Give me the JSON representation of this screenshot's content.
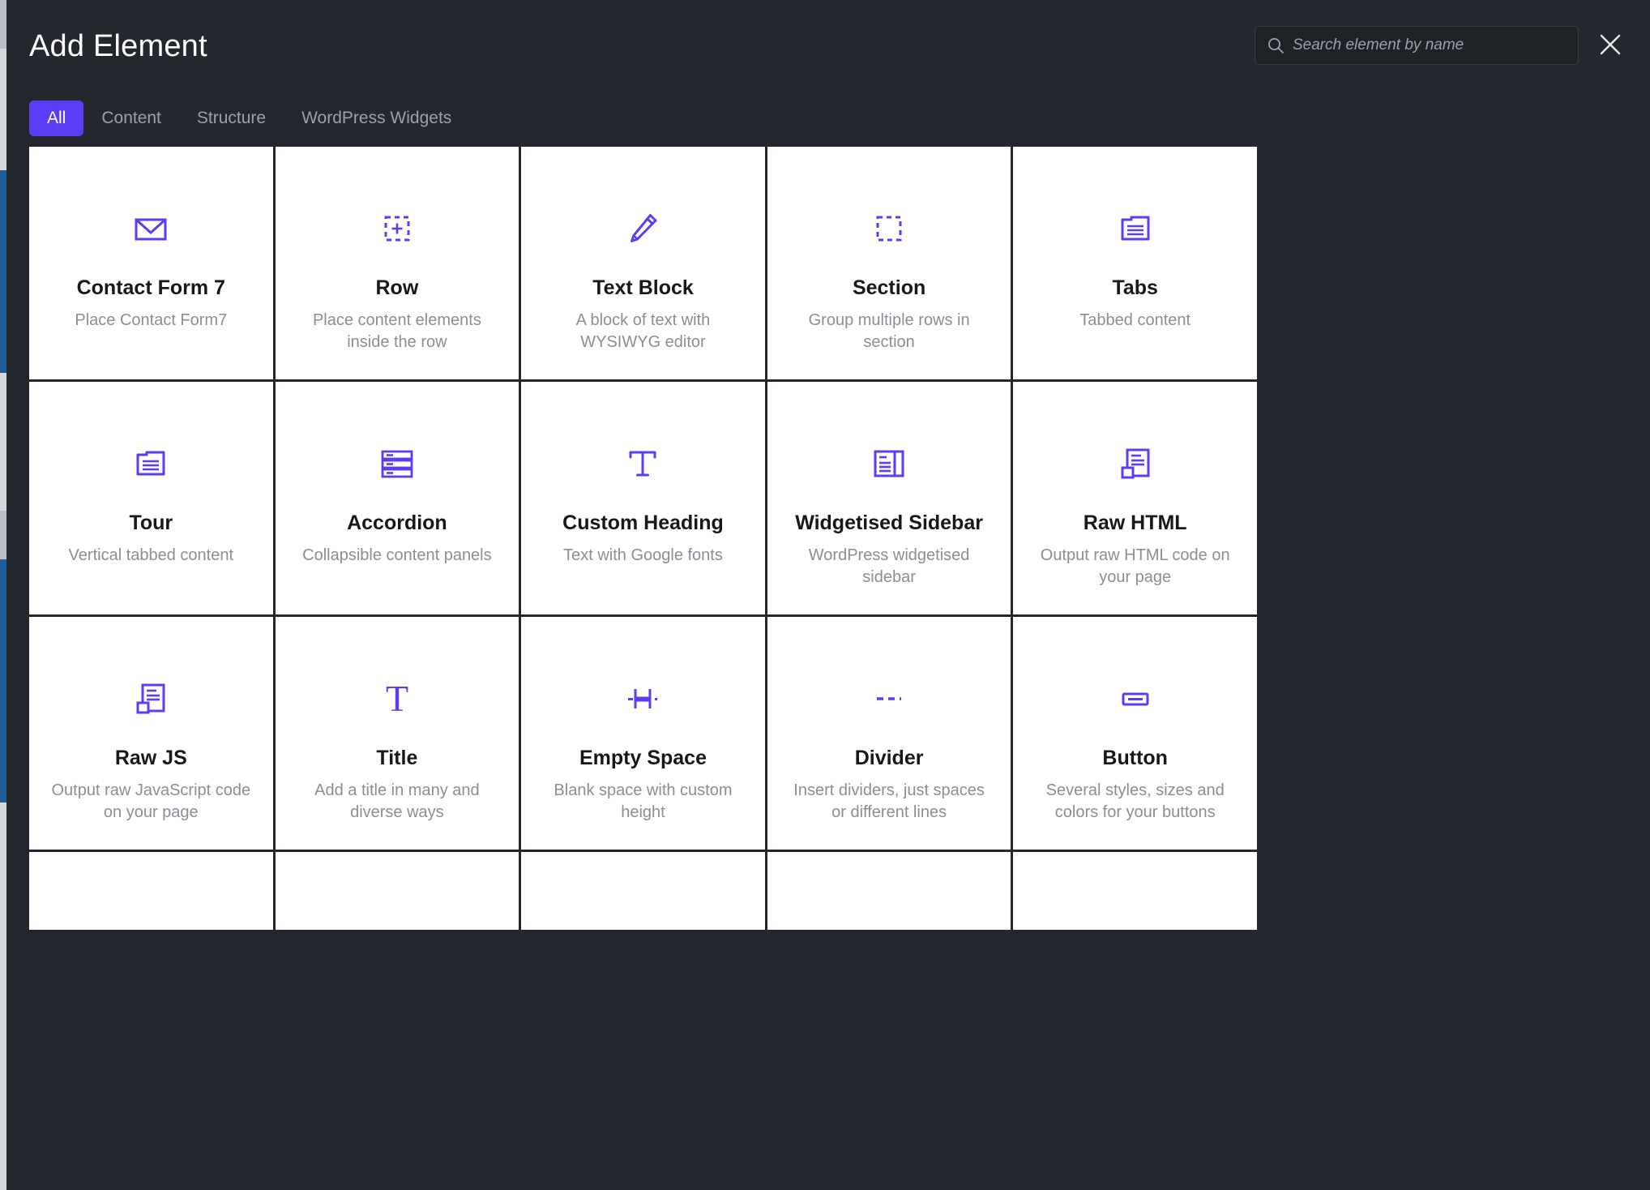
{
  "header": {
    "title": "Add Element",
    "search_placeholder": "Search element by name",
    "search_value": "",
    "search_icon": "search-icon",
    "close_icon": "close-icon"
  },
  "accent_color": "#5b3df5",
  "icon_color": "#5b3df5",
  "background_color": "#24282e",
  "card_background": "#ffffff",
  "tabs": [
    {
      "label": "All",
      "active": true
    },
    {
      "label": "Content",
      "active": false
    },
    {
      "label": "Structure",
      "active": false
    },
    {
      "label": "WordPress Widgets",
      "active": false
    }
  ],
  "elements": [
    {
      "title": "Contact Form 7",
      "desc": "Place Contact Form7",
      "icon": "envelope-icon"
    },
    {
      "title": "Row",
      "desc": "Place content elements inside the row",
      "icon": "dashed-square-plus-icon"
    },
    {
      "title": "Text Block",
      "desc": "A block of text with WYSIWYG editor",
      "icon": "pencil-icon"
    },
    {
      "title": "Section",
      "desc": "Group multiple rows in section",
      "icon": "dashed-square-icon"
    },
    {
      "title": "Tabs",
      "desc": "Tabbed content",
      "icon": "tabs-icon"
    },
    {
      "title": "Tour",
      "desc": "Vertical tabbed content",
      "icon": "tabs-icon"
    },
    {
      "title": "Accordion",
      "desc": "Collapsible content panels",
      "icon": "accordion-icon"
    },
    {
      "title": "Custom Heading",
      "desc": "Text with Google fonts",
      "icon": "serif-t-outline-icon"
    },
    {
      "title": "Widgetised Sidebar",
      "desc": "WordPress widgetised sidebar",
      "icon": "sidebar-layout-icon"
    },
    {
      "title": "Raw HTML",
      "desc": "Output raw HTML code on your page",
      "icon": "code-page-icon"
    },
    {
      "title": "Raw JS",
      "desc": "Output raw JavaScript code on your page",
      "icon": "code-page-icon"
    },
    {
      "title": "Title",
      "desc": "Add a title in many and diverse ways",
      "icon": "serif-t-icon"
    },
    {
      "title": "Empty Space",
      "desc": "Blank space with custom height",
      "icon": "empty-space-icon"
    },
    {
      "title": "Divider",
      "desc": "Insert dividers, just spaces or different lines",
      "icon": "dashed-line-icon"
    },
    {
      "title": "Button",
      "desc": "Several styles, sizes and colors for your buttons",
      "icon": "button-icon"
    }
  ],
  "partial_row_count": 5
}
